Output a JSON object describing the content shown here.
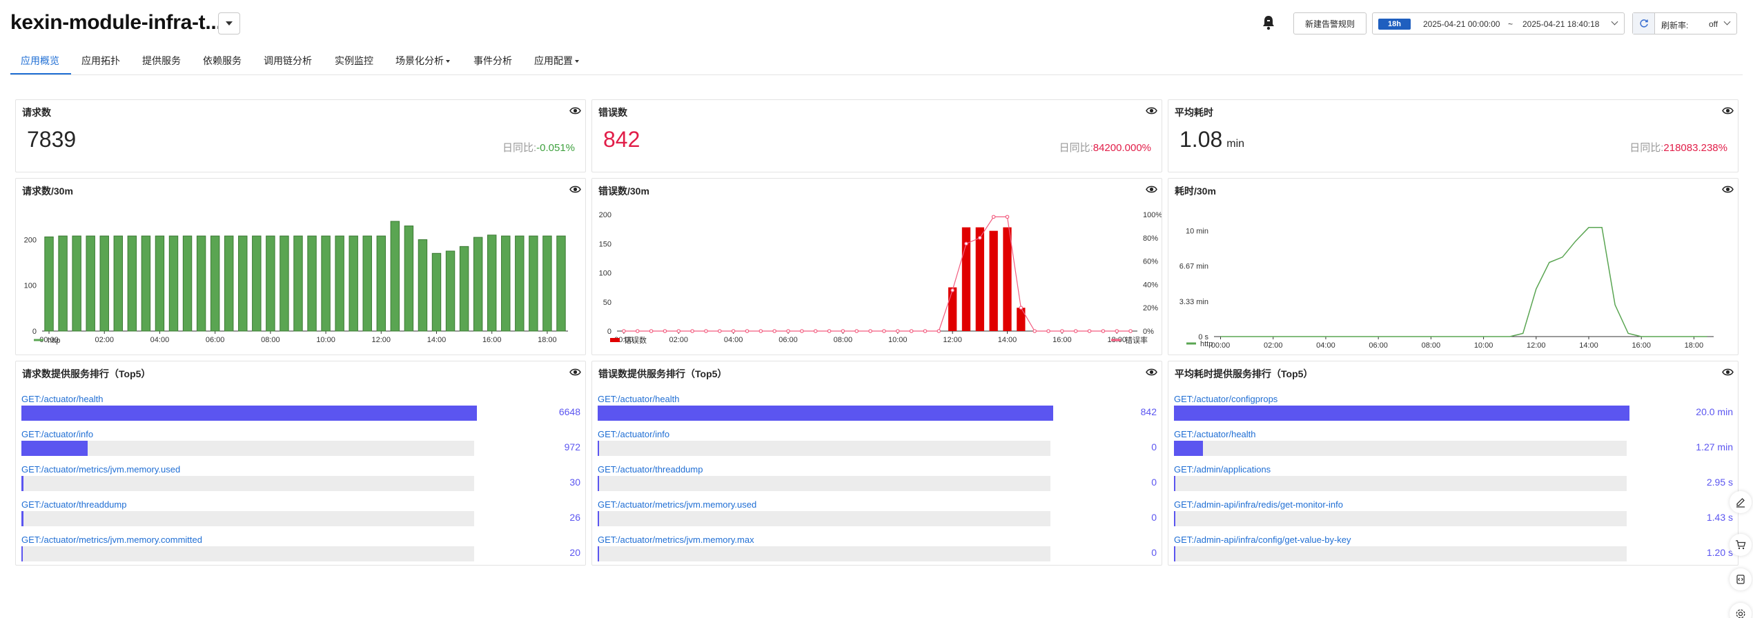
{
  "app": {
    "title": "kexin-module-infra-t...",
    "alarm_button": "新建告警规则",
    "time_range": {
      "badge": "18h",
      "start": "2025-04-21 00:00:00",
      "separator": "~",
      "end": "2025-04-21 18:40:18"
    },
    "refresh": {
      "label": "刷新率:",
      "value": "off"
    }
  },
  "tabs": [
    {
      "label": "应用概览",
      "active": true
    },
    {
      "label": "应用拓扑"
    },
    {
      "label": "提供服务"
    },
    {
      "label": "依赖服务"
    },
    {
      "label": "调用链分析"
    },
    {
      "label": "实例监控"
    },
    {
      "label": "场景化分析",
      "has_dropdown": true
    },
    {
      "label": "事件分析"
    },
    {
      "label": "应用配置",
      "has_dropdown": true
    }
  ],
  "stats": [
    {
      "title": "请求数",
      "value": "7839",
      "unit": "",
      "ratio_label": "日同比:",
      "ratio": "-0.051%",
      "ratio_color": "#3fa13f",
      "value_color": "#262626"
    },
    {
      "title": "错误数",
      "value": "842",
      "unit": "",
      "ratio_label": "日同比:",
      "ratio": "84200.000%",
      "ratio_color": "#e11d48",
      "value_color": "#e11d48"
    },
    {
      "title": "平均耗时",
      "value": "1.08",
      "unit": "min",
      "ratio_label": "日同比:",
      "ratio": "218083.238%",
      "ratio_color": "#e11d48",
      "value_color": "#262626"
    }
  ],
  "chart_titles": {
    "requests": "请求数/30m",
    "errors": "错误数/30m",
    "latency": "耗时/30m"
  },
  "chart_data": [
    {
      "type": "bar",
      "title": "请求数/30m",
      "x_ticks": [
        "00:00",
        "02:00",
        "04:00",
        "06:00",
        "08:00",
        "10:00",
        "12:00",
        "14:00",
        "16:00",
        "18:00"
      ],
      "y_ticks": [
        "0",
        "100",
        "200"
      ],
      "ylim": [
        0,
        270
      ],
      "series": [
        {
          "name": "http",
          "color": "#5aa552",
          "values": [
            206,
            208,
            208,
            208,
            208,
            208,
            208,
            208,
            208,
            208,
            208,
            208,
            208,
            208,
            208,
            208,
            208,
            208,
            208,
            208,
            208,
            208,
            208,
            208,
            208,
            240,
            230,
            200,
            170,
            175,
            185,
            205,
            210,
            208,
            208,
            208,
            208,
            208
          ]
        }
      ]
    },
    {
      "type": "bar+line",
      "title": "错误数/30m",
      "x_ticks": [
        "00:00",
        "02:00",
        "04:00",
        "06:00",
        "08:00",
        "10:00",
        "12:00",
        "14:00",
        "16:00",
        "18:00"
      ],
      "y_ticks": [
        "0",
        "50",
        "100",
        "150",
        "200"
      ],
      "y2_ticks": [
        "0%",
        "20%",
        "40%",
        "60%",
        "80%",
        "100%"
      ],
      "ylim": [
        0,
        200
      ],
      "y2lim": [
        0,
        100
      ],
      "series": [
        {
          "name": "错误数",
          "type": "bar",
          "color": "#e00000",
          "values": [
            0,
            0,
            0,
            0,
            0,
            0,
            0,
            0,
            0,
            0,
            0,
            0,
            0,
            0,
            0,
            0,
            0,
            0,
            0,
            0,
            0,
            0,
            0,
            0,
            75,
            178,
            178,
            172,
            178,
            40,
            0,
            0,
            0,
            0,
            0,
            0,
            0,
            0
          ]
        },
        {
          "name": "错误率",
          "type": "line",
          "color": "#f25c7f",
          "values": [
            0,
            0,
            0,
            0,
            0,
            0,
            0,
            0,
            0,
            0,
            0,
            0,
            0,
            0,
            0,
            0,
            0,
            0,
            0,
            0,
            0,
            0,
            0,
            0,
            35,
            75,
            80,
            98,
            98,
            20,
            0,
            0,
            0,
            0,
            0,
            0,
            0,
            0
          ]
        }
      ]
    },
    {
      "type": "line",
      "title": "耗时/30m",
      "x_ticks": [
        "00:00",
        "02:00",
        "04:00",
        "06:00",
        "08:00",
        "10:00",
        "12:00",
        "14:00",
        "16:00",
        "18:00"
      ],
      "y_ticks": [
        "0 s",
        "3.33 min",
        "6.67 min",
        "10 min"
      ],
      "ylim": [
        0,
        11
      ],
      "series": [
        {
          "name": "http",
          "color": "#5aa552",
          "values": [
            0,
            0,
            0,
            0,
            0,
            0,
            0,
            0,
            0,
            0,
            0,
            0,
            0,
            0,
            0,
            0,
            0,
            0,
            0,
            0,
            0,
            0,
            0,
            0.3,
            4.5,
            7,
            7.5,
            9,
            10.3,
            10.3,
            3,
            0.3,
            0,
            0,
            0,
            0,
            0,
            0
          ]
        }
      ]
    }
  ],
  "rank_titles": {
    "requests": "请求数提供服务排行（Top5）",
    "errors": "错误数提供服务排行（Top5）",
    "latency": "平均耗时提供服务排行（Top5）"
  },
  "rankings": {
    "requests": [
      {
        "label": "GET:/actuator/health",
        "value": "6648",
        "fraction": 1.0
      },
      {
        "label": "GET:/actuator/info",
        "value": "972",
        "fraction": 0.146
      },
      {
        "label": "GET:/actuator/metrics/jvm.memory.used",
        "value": "30",
        "fraction": 0.005
      },
      {
        "label": "GET:/actuator/threaddump",
        "value": "26",
        "fraction": 0.004
      },
      {
        "label": "GET:/actuator/metrics/jvm.memory.committed",
        "value": "20",
        "fraction": 0.003
      }
    ],
    "errors": [
      {
        "label": "GET:/actuator/health",
        "value": "842",
        "fraction": 1.0
      },
      {
        "label": "GET:/actuator/info",
        "value": "0",
        "fraction": 0.002
      },
      {
        "label": "GET:/actuator/threaddump",
        "value": "0",
        "fraction": 0.002
      },
      {
        "label": "GET:/actuator/metrics/jvm.memory.used",
        "value": "0",
        "fraction": 0.002
      },
      {
        "label": "GET:/actuator/metrics/jvm.memory.max",
        "value": "0",
        "fraction": 0.002
      }
    ],
    "latency": [
      {
        "label": "GET:/actuator/configprops",
        "value": "20.0 min",
        "fraction": 1.0
      },
      {
        "label": "GET:/actuator/health",
        "value": "1.27 min",
        "fraction": 0.063
      },
      {
        "label": "GET:/admin/applications",
        "value": "2.95 s",
        "fraction": 0.003
      },
      {
        "label": "GET:/admin-api/infra/redis/get-monitor-info",
        "value": "1.43 s",
        "fraction": 0.002
      },
      {
        "label": "GET:/admin-api/infra/config/get-value-by-key",
        "value": "1.20 s",
        "fraction": 0.002
      }
    ]
  },
  "float_toolbar": [
    "edit-icon",
    "cart-icon",
    "code-icon",
    "settings-icon"
  ]
}
